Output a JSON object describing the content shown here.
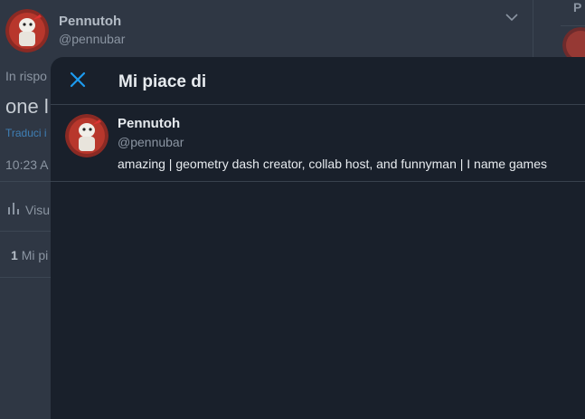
{
  "background": {
    "author": {
      "name": "Pennutoh",
      "handle": "@pennubar"
    },
    "reply_prefix": "In rispo",
    "tweet_text": "one l",
    "translate_link": "Traduci i",
    "time": "10:23 A",
    "views_label": "Visu",
    "likes_count": "1",
    "likes_label": "Mi pi",
    "right_panel_letter": "P"
  },
  "modal": {
    "title": "Mi piace di",
    "close_icon": "close-icon",
    "users": [
      {
        "name": "Pennutoh",
        "handle": "@pennubar",
        "bio": "amazing | geometry dash creator, collab host, and funnyman | I name games"
      }
    ]
  },
  "colors": {
    "page_bg": "#2f3744",
    "modal_bg": "#19202b",
    "accent": "#1d9bf0",
    "divider": "#38414d"
  }
}
